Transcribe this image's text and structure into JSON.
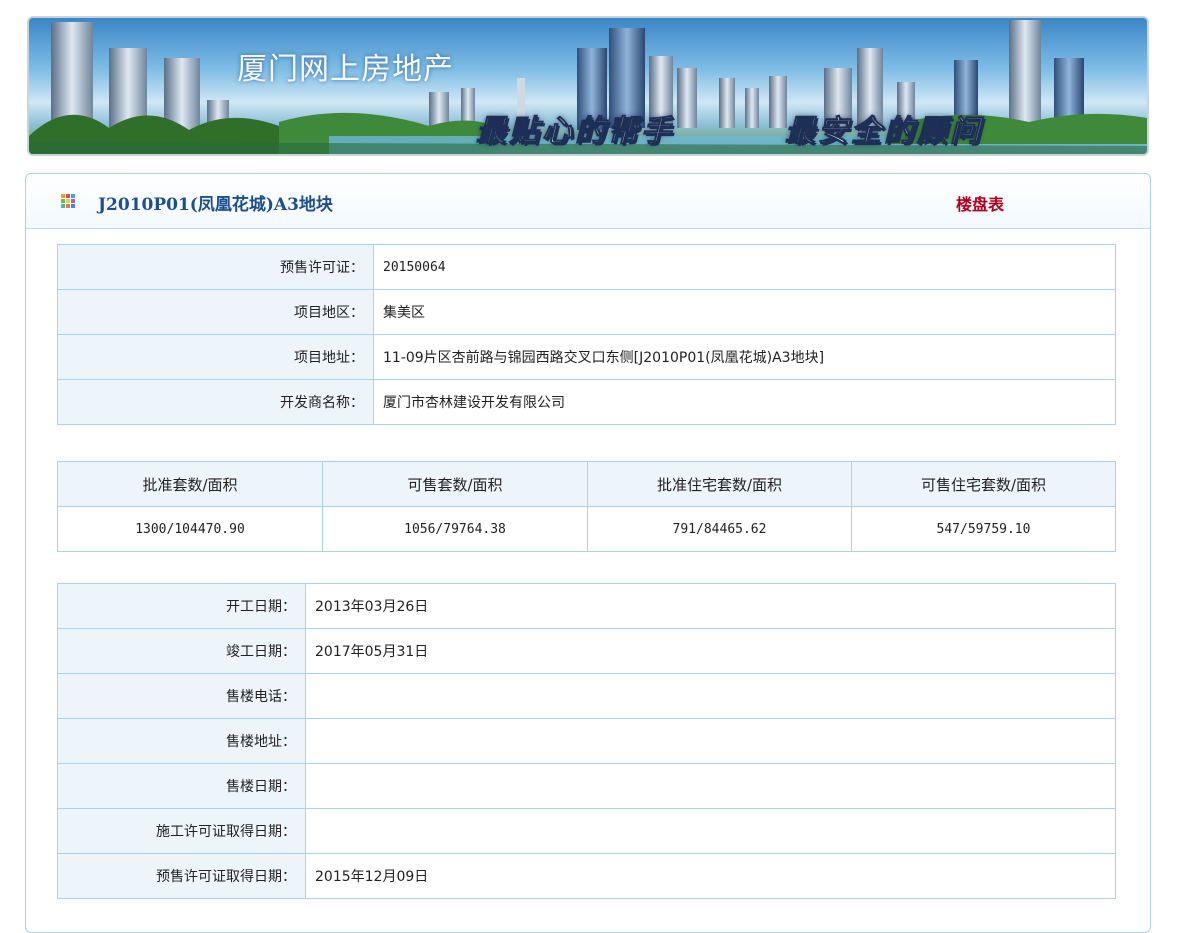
{
  "banner": {
    "site_title": "厦门网上房地产",
    "slogan_1": "最贴心的帮手",
    "slogan_2": "最安全的顾问"
  },
  "header": {
    "project_title": "J2010P01(凤凰花城)A3地块",
    "listing_link": "楼盘表"
  },
  "basic_info": {
    "rows": [
      {
        "label": "预售许可证：",
        "value": "20150064"
      },
      {
        "label": "项目地区：",
        "value": "集美区"
      },
      {
        "label": "项目地址：",
        "value": "11-09片区杏前路与锦园西路交叉口东侧[J2010P01(凤凰花城)A3地块]"
      },
      {
        "label": "开发商名称：",
        "value": "厦门市杏林建设开发有限公司"
      }
    ]
  },
  "stats": {
    "headers": [
      "批准套数/面积",
      "可售套数/面积",
      "批准住宅套数/面积",
      "可售住宅套数/面积"
    ],
    "values": [
      "1300/104470.90",
      "1056/79764.38",
      "791/84465.62",
      "547/59759.10"
    ]
  },
  "dates": {
    "rows": [
      {
        "label": "开工日期：",
        "value": "2013年03月26日"
      },
      {
        "label": "竣工日期：",
        "value": "2017年05月31日"
      },
      {
        "label": "售楼电话：",
        "value": ""
      },
      {
        "label": "售楼地址：",
        "value": ""
      },
      {
        "label": "售楼日期：",
        "value": ""
      },
      {
        "label": "施工许可证取得日期：",
        "value": ""
      },
      {
        "label": "预售许可证取得日期：",
        "value": "2015年12月09日"
      }
    ]
  },
  "colors": {
    "title_blue": "#1d4f8c",
    "link_red": "#b1001e",
    "border_blue": "#a9d2ec",
    "label_bg": "#edf5fb"
  }
}
